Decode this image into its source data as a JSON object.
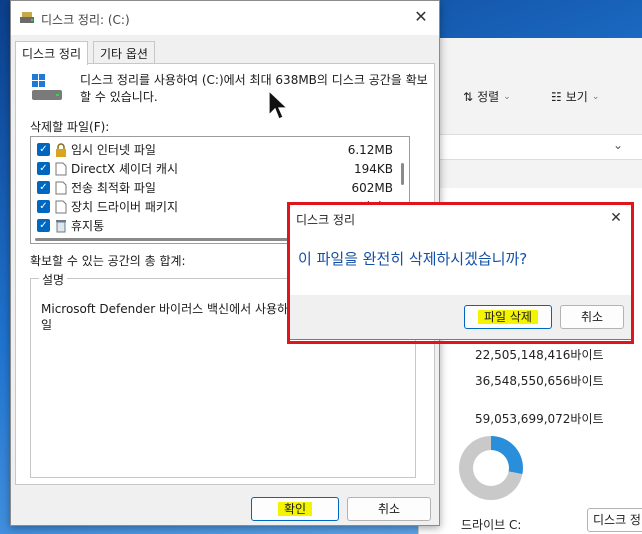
{
  "colors": {
    "accent": "#0067c0",
    "highlight": "#f4f400",
    "red_frame": "#e0151c",
    "confirm_text": "#1450a8"
  },
  "explorer": {
    "sort_label": "정렬",
    "view_label": "보기",
    "rows": [
      "22,505,148,416바이트",
      "36,548,550,656바이트",
      "59,053,699,072바이트"
    ],
    "drive_label": "드라이브 C:",
    "cleanup_button": "디스크 정"
  },
  "dialog": {
    "title": "디스크 정리: (C:)",
    "tabs": [
      "디스크 정리",
      "기타 옵션"
    ],
    "intro": "디스크 정리를 사용하여 (C:)에서 최대 638MB의 디스크 공간을 확보할 수 있습니다.",
    "files_label": "삭제할 파일(F):",
    "files": [
      {
        "name": "임시 인터넷 파일",
        "size": "6.12MB",
        "icon": "lock-icon",
        "checked": true
      },
      {
        "name": "DirectX 셰이더 캐시",
        "size": "194KB",
        "icon": "document-icon",
        "checked": true
      },
      {
        "name": "전송 최적화 파일",
        "size": "602MB",
        "icon": "document-icon",
        "checked": true
      },
      {
        "name": "장치 드라이버 패키지",
        "size": "0바이트",
        "icon": "document-icon",
        "checked": true
      },
      {
        "name": "휴지통",
        "size": "",
        "icon": "recycle-bin-icon",
        "checked": true
      }
    ],
    "total_label": "확보할 수 있는 공간의 총 합계:",
    "description_legend": "설명",
    "description_text": [
      "Microsoft Defender 바이러스 백신에서 사용하",
      "일"
    ],
    "ok_button": "확인",
    "cancel_button": "취소"
  },
  "confirm": {
    "title": "디스크 정리",
    "message": "이 파일을 완전히 삭제하시겠습니까?",
    "delete_button": "파일 삭제",
    "cancel_button": "취소"
  }
}
